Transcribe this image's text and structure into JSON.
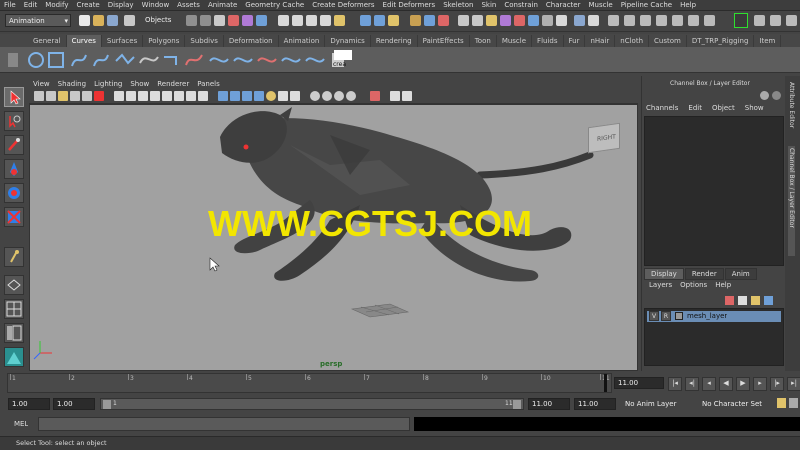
{
  "menu": [
    "File",
    "Edit",
    "Modify",
    "Create",
    "Display",
    "Window",
    "Assets",
    "Animate",
    "Geometry Cache",
    "Create Deformers",
    "Edit Deformers",
    "Skeleton",
    "Skin",
    "Constrain",
    "Character",
    "Muscle",
    "Pipeline Cache",
    "Help"
  ],
  "status_line": {
    "mode": "Animation",
    "selection_mode": "Objects"
  },
  "shelf_tabs": [
    "General",
    "Curves",
    "Surfaces",
    "Polygons",
    "Subdivs",
    "Deformation",
    "Animation",
    "Dynamics",
    "Rendering",
    "PaintEffects",
    "Toon",
    "Muscle",
    "Fluids",
    "Fur",
    "nHair",
    "nCloth",
    "Custom",
    "DT_TRP_Rigging",
    "Item"
  ],
  "shelf_active": "Curves",
  "shelf_last_label": "crea",
  "viewport": {
    "menus": [
      "View",
      "Shading",
      "Lighting",
      "Show",
      "Renderer",
      "Panels"
    ],
    "camera_label": "persp",
    "viewcube_label": "RIGHT",
    "watermark": "WWW.CGTSJ.COM"
  },
  "channel_box": {
    "title": "Channel Box / Layer Editor",
    "menus": [
      "Channels",
      "Edit",
      "Object",
      "Show"
    ]
  },
  "layer_editor": {
    "tabs": [
      "Display",
      "Render",
      "Anim"
    ],
    "active_tab": "Display",
    "menus": [
      "Layers",
      "Options",
      "Help"
    ],
    "layer": {
      "v": "V",
      "r": "R",
      "name": "mesh_layer"
    }
  },
  "side_tabs": [
    "Attribute Editor",
    "Channel Box / Layer Editor"
  ],
  "time_slider": {
    "ticks": [
      "1",
      "2",
      "3",
      "4",
      "5",
      "6",
      "7",
      "8",
      "9",
      "10",
      "11"
    ],
    "current_time": "11.00"
  },
  "range_slider": {
    "start_time": "1.00",
    "playback_start": "1.00",
    "range_start_label": "1",
    "range_end_label": "11",
    "playback_end": "11.00",
    "end_time": "11.00",
    "anim_layer": "No Anim Layer",
    "character_set": "No Character Set"
  },
  "command_line": {
    "label": "MEL"
  },
  "help_line": "Select Tool: select an object",
  "colors": {
    "viewport_bg": "#a1a1a1",
    "watermark": "#f2e600",
    "accent": "#6fa0d8"
  }
}
